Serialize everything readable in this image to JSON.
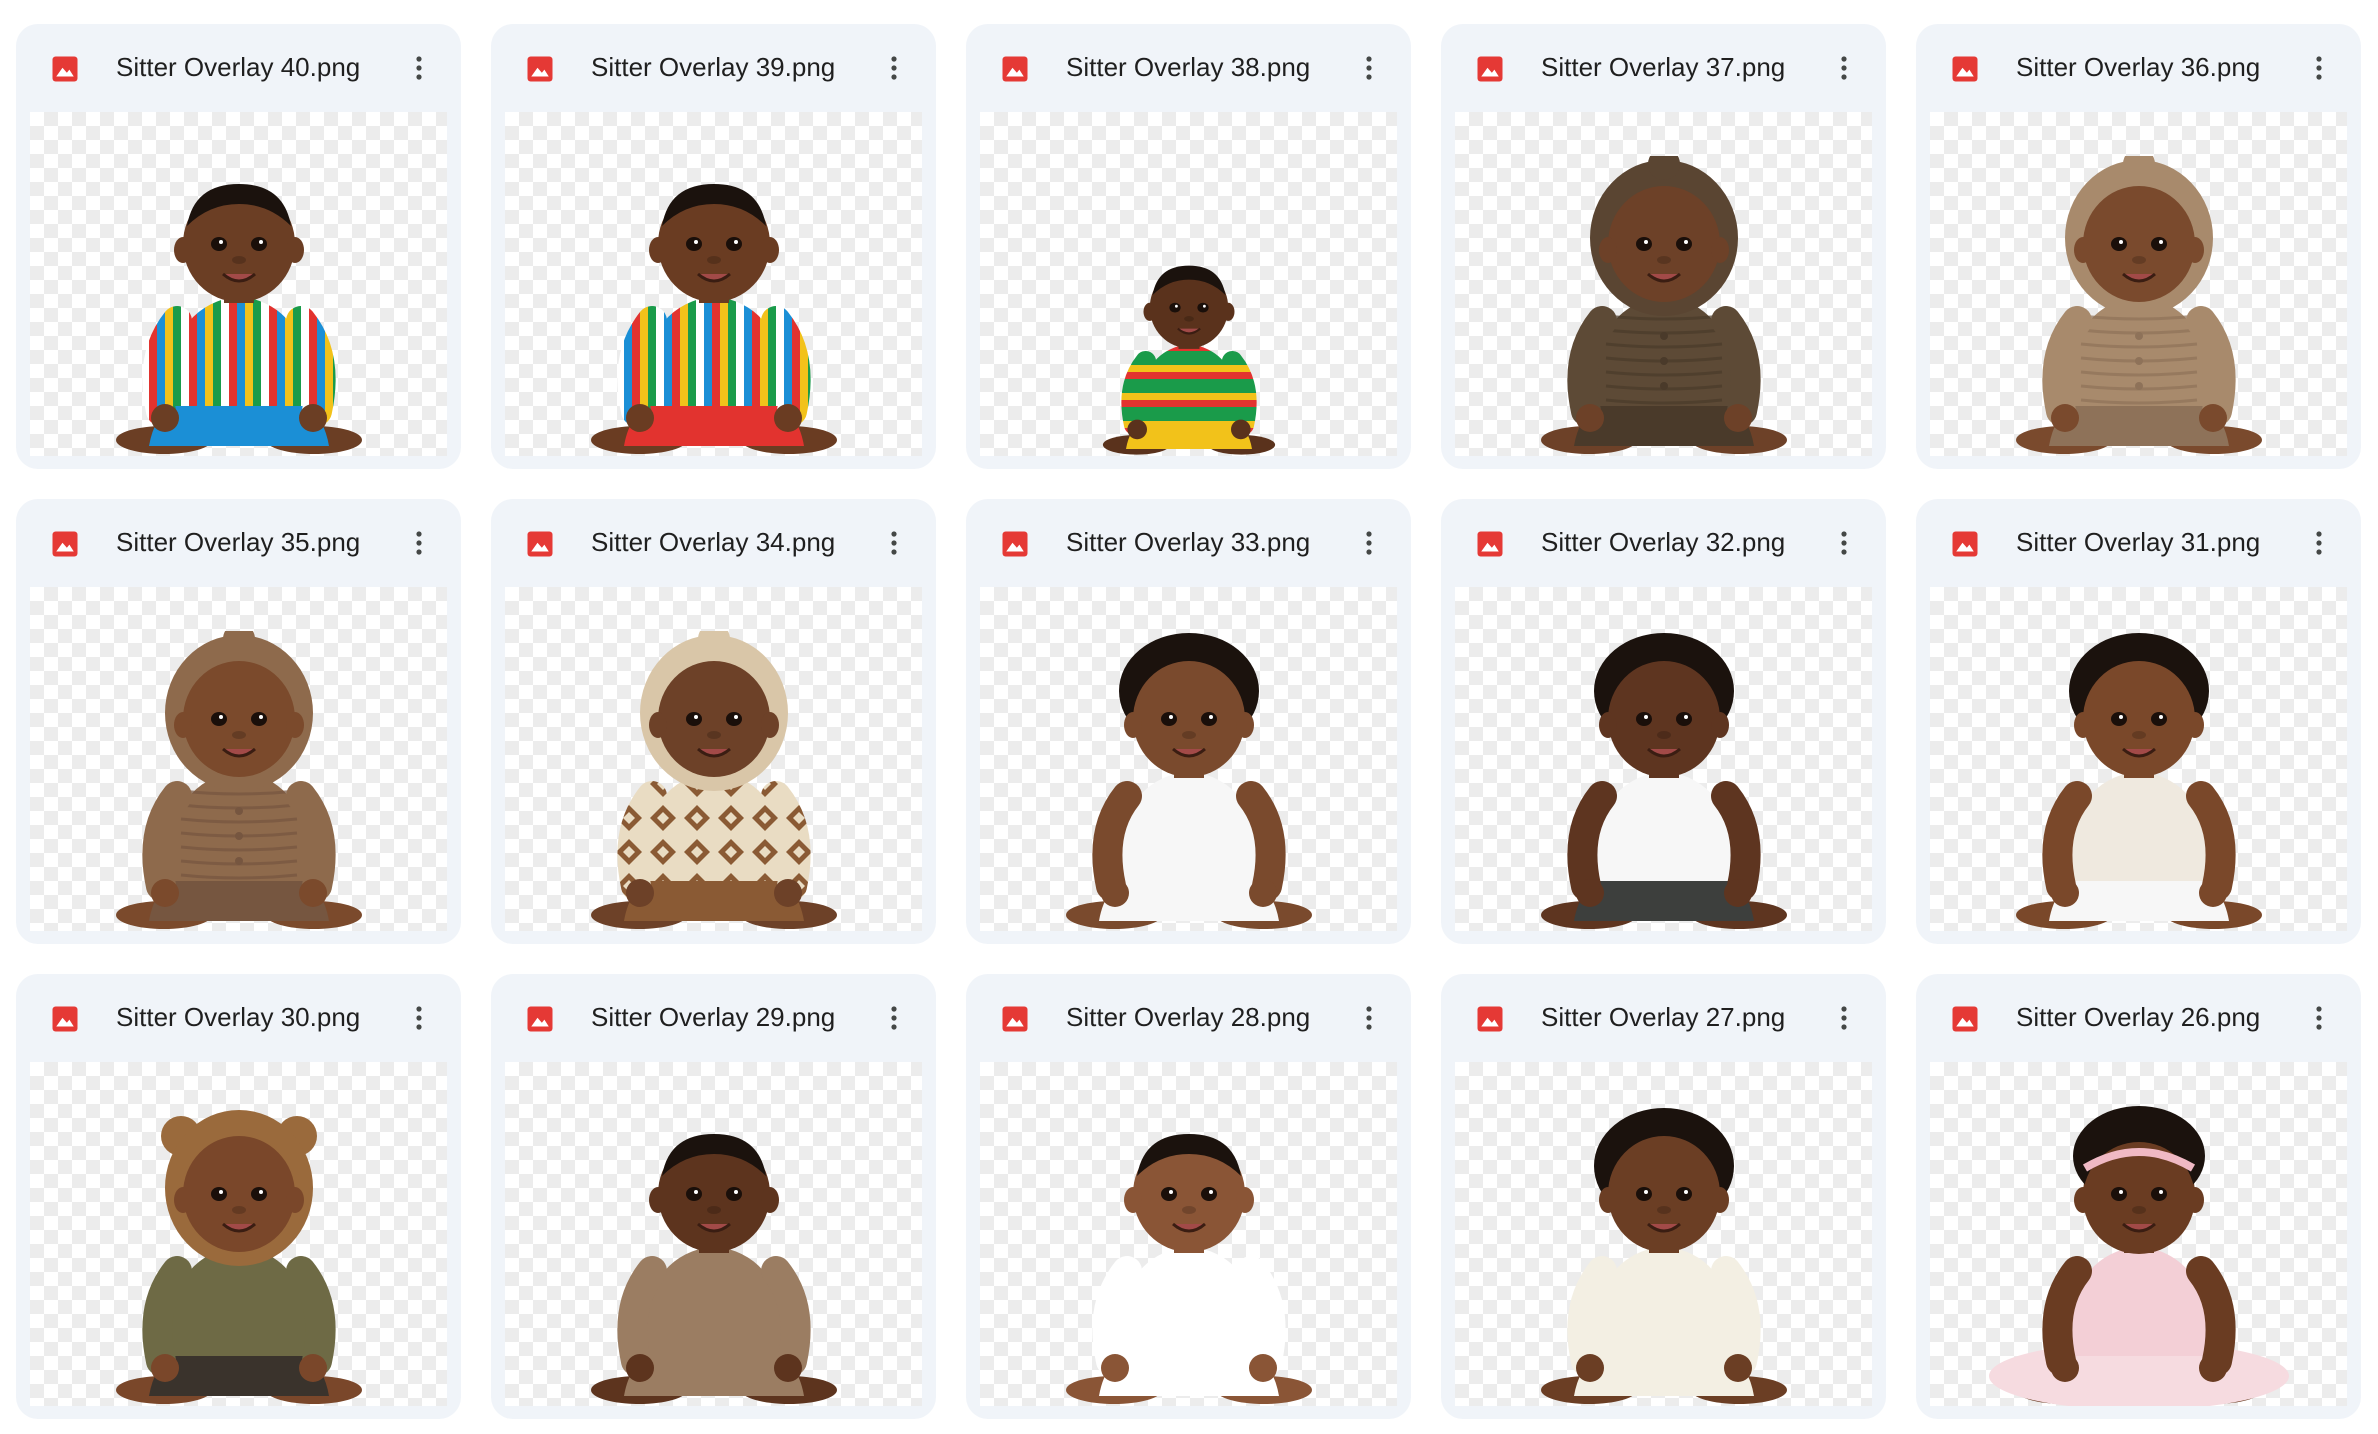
{
  "files": [
    {
      "name": "Sitter Overlay 40.png",
      "skin": "#6b3e24",
      "hair": "#1b120d",
      "outfit": "stripes",
      "outfit_colors": [
        "#e2332f",
        "#1b8fd6",
        "#f2c21a",
        "#1a9b4a",
        "#ffffff"
      ],
      "headwear": "none",
      "pose_scale": 1.0
    },
    {
      "name": "Sitter Overlay 39.png",
      "skin": "#6a3c22",
      "hair": "#1b120d",
      "outfit": "stripes",
      "outfit_colors": [
        "#1b8fd6",
        "#e2332f",
        "#f2c21a",
        "#1a9b4a",
        "#ffffff"
      ],
      "headwear": "none",
      "pose_scale": 1.0
    },
    {
      "name": "Sitter Overlay 38.png",
      "skin": "#5a321c",
      "hair": "#1b120d",
      "outfit": "stripes",
      "outfit_colors": [
        "#1a9b4a",
        "#f2c21a",
        "#e2332f",
        "#1a9b4a"
      ],
      "headwear": "none",
      "pose_scale": 0.7
    },
    {
      "name": "Sitter Overlay 37.png",
      "skin": "#6d4128",
      "hair": "#5a4532",
      "outfit": "knit",
      "outfit_colors": [
        "#5d4a36",
        "#4a3a2a"
      ],
      "headwear": "hood",
      "pose_scale": 1.0
    },
    {
      "name": "Sitter Overlay 36.png",
      "skin": "#7a4a2d",
      "hair": "#a88a6c",
      "outfit": "knit",
      "outfit_colors": [
        "#a88a6c",
        "#8e7259"
      ],
      "headwear": "hood",
      "pose_scale": 1.0
    },
    {
      "name": "Sitter Overlay 35.png",
      "skin": "#7b4a2c",
      "hair": "#8e6a4c",
      "outfit": "knit",
      "outfit_colors": [
        "#8e6a4c",
        "#765640"
      ],
      "headwear": "hood",
      "pose_scale": 1.0
    },
    {
      "name": "Sitter Overlay 34.png",
      "skin": "#6d4128",
      "hair": "#d9c6a8",
      "outfit": "pattern",
      "outfit_colors": [
        "#e9dcc3",
        "#8a5a34"
      ],
      "headwear": "hood",
      "pose_scale": 1.0
    },
    {
      "name": "Sitter Overlay 33.png",
      "skin": "#7a4a2d",
      "hair": "#1b120d",
      "outfit": "plain",
      "outfit_colors": [
        "#f7f7f7",
        "#f7f7f7"
      ],
      "headwear": "curls",
      "pose_scale": 1.0
    },
    {
      "name": "Sitter Overlay 32.png",
      "skin": "#5e3520",
      "hair": "#1b120d",
      "outfit": "plain",
      "outfit_colors": [
        "#f7f7f7",
        "#3d3f3d"
      ],
      "headwear": "curls",
      "pose_scale": 1.0
    },
    {
      "name": "Sitter Overlay 31.png",
      "skin": "#7a482a",
      "hair": "#1b120d",
      "outfit": "plain",
      "outfit_colors": [
        "#efe9df",
        "#f7f7f7"
      ],
      "headwear": "curls",
      "pose_scale": 1.0
    },
    {
      "name": "Sitter Overlay 30.png",
      "skin": "#7a472a",
      "hair": "#9a6a3c",
      "outfit": "plain",
      "outfit_colors": [
        "#6e6a45",
        "#3a332c"
      ],
      "headwear": "bear",
      "pose_scale": 1.0
    },
    {
      "name": "Sitter Overlay 29.png",
      "skin": "#5d341e",
      "hair": "#1b120d",
      "outfit": "plain",
      "outfit_colors": [
        "#9b7d62",
        "#9b7d62"
      ],
      "headwear": "none",
      "pose_scale": 1.0
    },
    {
      "name": "Sitter Overlay 28.png",
      "skin": "#8a5536",
      "hair": "#1b120d",
      "outfit": "plain",
      "outfit_colors": [
        "#ffffff",
        "#ffffff"
      ],
      "headwear": "none",
      "pose_scale": 1.0
    },
    {
      "name": "Sitter Overlay 27.png",
      "skin": "#6b3e24",
      "hair": "#1b120d",
      "outfit": "plain",
      "outfit_colors": [
        "#f3efe3",
        "#f3efe3"
      ],
      "headwear": "curls",
      "pose_scale": 1.0
    },
    {
      "name": "Sitter Overlay 26.png",
      "skin": "#6a3c22",
      "hair": "#1b120d",
      "outfit": "tutu",
      "outfit_colors": [
        "#f3cfd6",
        "#f6dbe0"
      ],
      "headwear": "headband",
      "pose_scale": 1.0
    }
  ],
  "icons": {
    "file_icon": "image-file-icon",
    "more_icon": "more-vertical-icon",
    "file_icon_color": "#e53935"
  }
}
